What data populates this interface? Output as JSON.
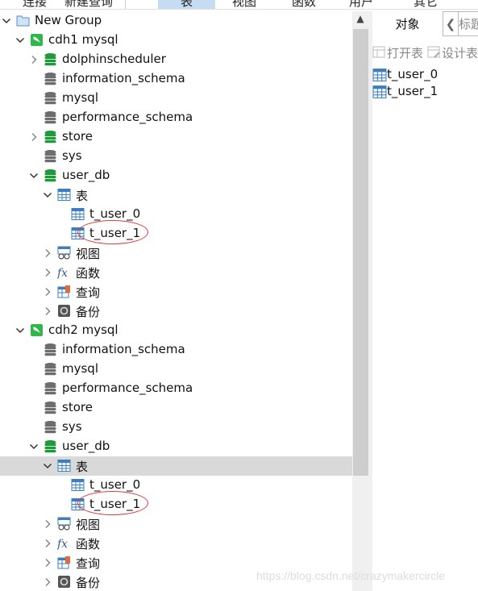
{
  "toolbar": {
    "items": [
      {
        "label": "连接"
      },
      {
        "label": "新建查询"
      },
      {
        "label": "表",
        "active": true
      },
      {
        "label": "视图"
      },
      {
        "label": "函数"
      },
      {
        "label": "用户"
      },
      {
        "label": "其它"
      }
    ]
  },
  "tree": [
    {
      "label": "New Group",
      "level": 0,
      "chev": "down",
      "icon": "folder"
    },
    {
      "label": "cdh1 mysql",
      "level": 1,
      "chev": "down",
      "icon": "mysql-connection"
    },
    {
      "label": "dolphinscheduler",
      "level": 2,
      "chev": "right",
      "icon": "db-green"
    },
    {
      "label": "information_schema",
      "level": 2,
      "chev": "",
      "icon": "db-gray"
    },
    {
      "label": "mysql",
      "level": 2,
      "chev": "",
      "icon": "db-gray"
    },
    {
      "label": "performance_schema",
      "level": 2,
      "chev": "",
      "icon": "db-gray"
    },
    {
      "label": "store",
      "level": 2,
      "chev": "right",
      "icon": "db-green"
    },
    {
      "label": "sys",
      "level": 2,
      "chev": "",
      "icon": "db-gray"
    },
    {
      "label": "user_db",
      "level": 2,
      "chev": "down",
      "icon": "db-green"
    },
    {
      "label": "表",
      "level": 3,
      "chev": "down",
      "icon": "table"
    },
    {
      "label": "t_user_0",
      "level": 4,
      "chev": "",
      "icon": "table"
    },
    {
      "label": "t_user_1",
      "level": 4,
      "chev": "",
      "icon": "table",
      "circled": true
    },
    {
      "label": "视图",
      "level": 3,
      "chev": "right",
      "icon": "view"
    },
    {
      "label": "函数",
      "level": 3,
      "chev": "right",
      "icon": "function"
    },
    {
      "label": "查询",
      "level": 3,
      "chev": "right",
      "icon": "query"
    },
    {
      "label": "备份",
      "level": 3,
      "chev": "right",
      "icon": "backup"
    },
    {
      "label": "cdh2 mysql",
      "level": 1,
      "chev": "down",
      "icon": "mysql-connection"
    },
    {
      "label": "information_schema",
      "level": 2,
      "chev": "",
      "icon": "db-gray"
    },
    {
      "label": "mysql",
      "level": 2,
      "chev": "",
      "icon": "db-gray"
    },
    {
      "label": "performance_schema",
      "level": 2,
      "chev": "",
      "icon": "db-gray"
    },
    {
      "label": "store",
      "level": 2,
      "chev": "",
      "icon": "db-gray"
    },
    {
      "label": "sys",
      "level": 2,
      "chev": "",
      "icon": "db-gray"
    },
    {
      "label": "user_db",
      "level": 2,
      "chev": "down",
      "icon": "db-green"
    },
    {
      "label": "表",
      "level": 3,
      "chev": "down",
      "icon": "table",
      "selected": true
    },
    {
      "label": "t_user_0",
      "level": 4,
      "chev": "",
      "icon": "table"
    },
    {
      "label": "t_user_1",
      "level": 4,
      "chev": "",
      "icon": "table",
      "circled": true
    },
    {
      "label": "视图",
      "level": 3,
      "chev": "right",
      "icon": "view"
    },
    {
      "label": "函数",
      "level": 3,
      "chev": "right",
      "icon": "function"
    },
    {
      "label": "查询",
      "level": 3,
      "chev": "right",
      "icon": "query"
    },
    {
      "label": "备份",
      "level": 3,
      "chev": "right",
      "icon": "backup"
    }
  ],
  "right": {
    "tab_objects": "对象",
    "tab_title": "标题",
    "open_table": "打开表",
    "design_table": "设计表",
    "objects": [
      "t_user_0",
      "t_user_1"
    ]
  },
  "watermark": "https://blog.csdn.net/crazymakercircle",
  "colors": {
    "selected_row": "#d9d9d9",
    "db_green": "#1f9a3a",
    "table_blue": "#3a7fc1",
    "annotation_red": "#e03c3c"
  }
}
